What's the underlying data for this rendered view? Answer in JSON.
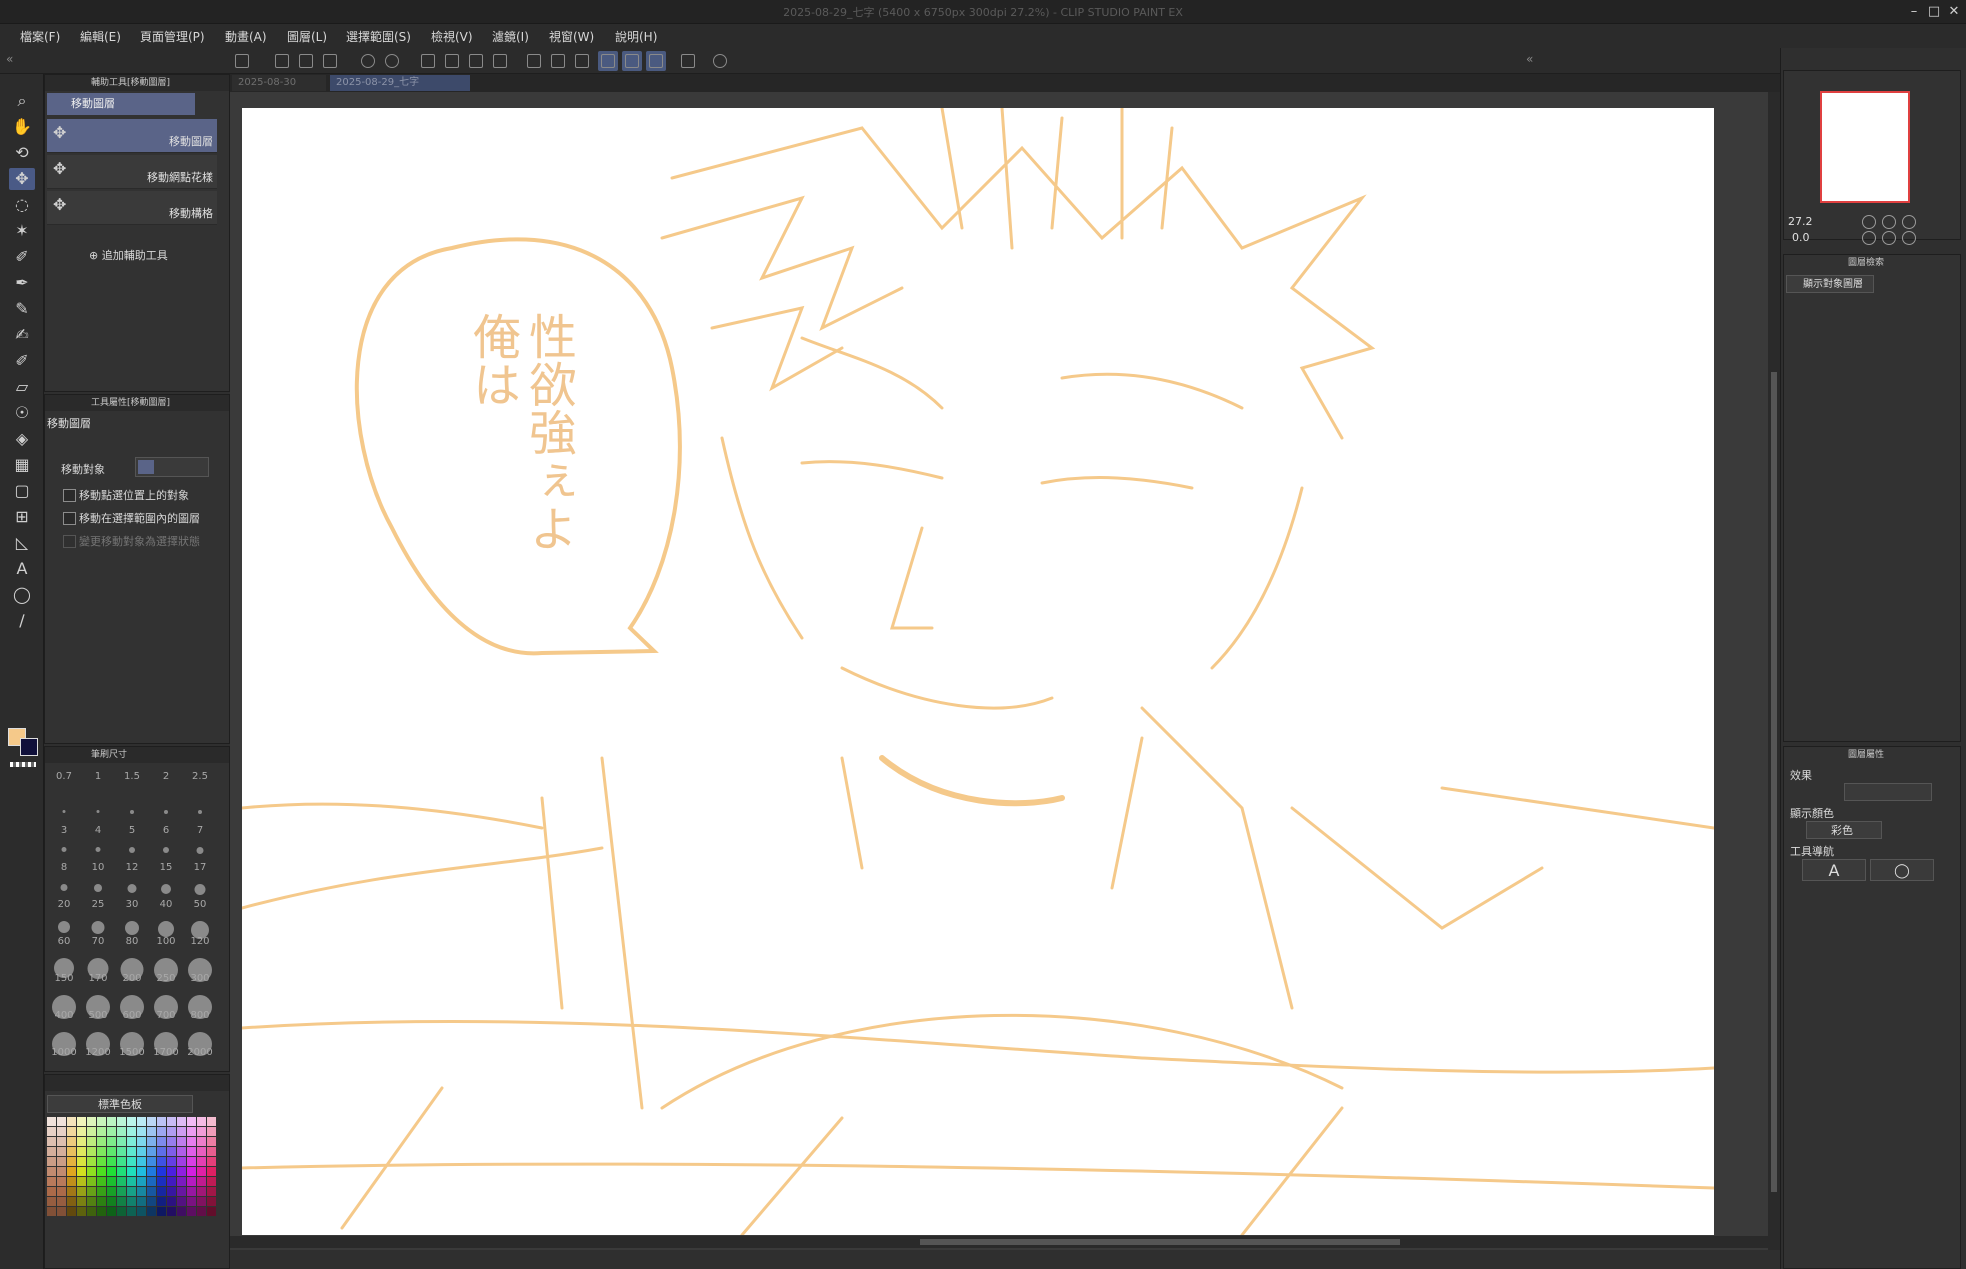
{
  "window": {
    "title": "2025-08-29_七字 (5400 x 6750px 300dpi 27.2%)  - CLIP STUDIO PAINT EX",
    "controls": [
      "–",
      "□",
      "✕"
    ]
  },
  "menubar": [
    "檔案(F)",
    "編輯(E)",
    "頁面管理(P)",
    "動畫(A)",
    "圖層(L)",
    "選擇範圍(S)",
    "檢視(V)",
    "濾鏡(I)",
    "視窗(W)",
    "說明(H)"
  ],
  "doc_tabs": [
    "2025-08-30",
    "2025-08-29_七字"
  ],
  "subtool_panel": {
    "title": "輔助工具[移動圖層]",
    "group_label": "移動圖層",
    "items": [
      {
        "label": "移動圖層",
        "icon": "move-arrows-icon",
        "active": true
      },
      {
        "label": "移動網點花樣",
        "icon": "move-arrows-icon",
        "active": false
      },
      {
        "label": "移動構格",
        "icon": "move-arrows-icon",
        "active": false
      }
    ],
    "add_label": "追加輔助工具"
  },
  "tool_property": {
    "title": "工具屬性[移動圖層]",
    "name": "移動圖層",
    "target_label": "移動對象",
    "options": [
      {
        "label": "移動點選位置上的對象",
        "enabled": true
      },
      {
        "label": "移動在選擇範圍內的圖層",
        "enabled": true
      },
      {
        "label": "變更移動對象為選擇狀態",
        "enabled": false
      }
    ]
  },
  "brush_size": {
    "title": "筆刷尺寸",
    "sizes": [
      "0.7",
      "1",
      "1.5",
      "2",
      "2.5",
      "3",
      "4",
      "5",
      "6",
      "7",
      "8",
      "10",
      "12",
      "15",
      "17",
      "20",
      "25",
      "30",
      "40",
      "50",
      "60",
      "70",
      "80",
      "100",
      "120",
      "150",
      "170",
      "200",
      "250",
      "300",
      "400",
      "500",
      "600",
      "700",
      "800",
      "1000",
      "1200",
      "1500",
      "1700",
      "2000"
    ]
  },
  "color_set": {
    "selector": "標準色板"
  },
  "canvas": {
    "speech_text_col1": "性欲強ぇよ",
    "speech_text_col2": "俺は",
    "line_color": "#f5c98a"
  },
  "navigator": {
    "zoom": "27.2",
    "rotation": "0.0"
  },
  "layer_search": {
    "tab_label": "圖層檢索",
    "filter_label": "顯示對象圖層"
  },
  "layer_property": {
    "tab_label": "圖層屬性",
    "effect_label": "效果",
    "display_color_label": "顯示顏色",
    "display_color_value": "彩色",
    "tool_nav_label": "工具導航"
  },
  "colors": {
    "accent": "#4a5a86",
    "main_color": "#f5c98a",
    "sub_color": "#1a1a8a"
  }
}
